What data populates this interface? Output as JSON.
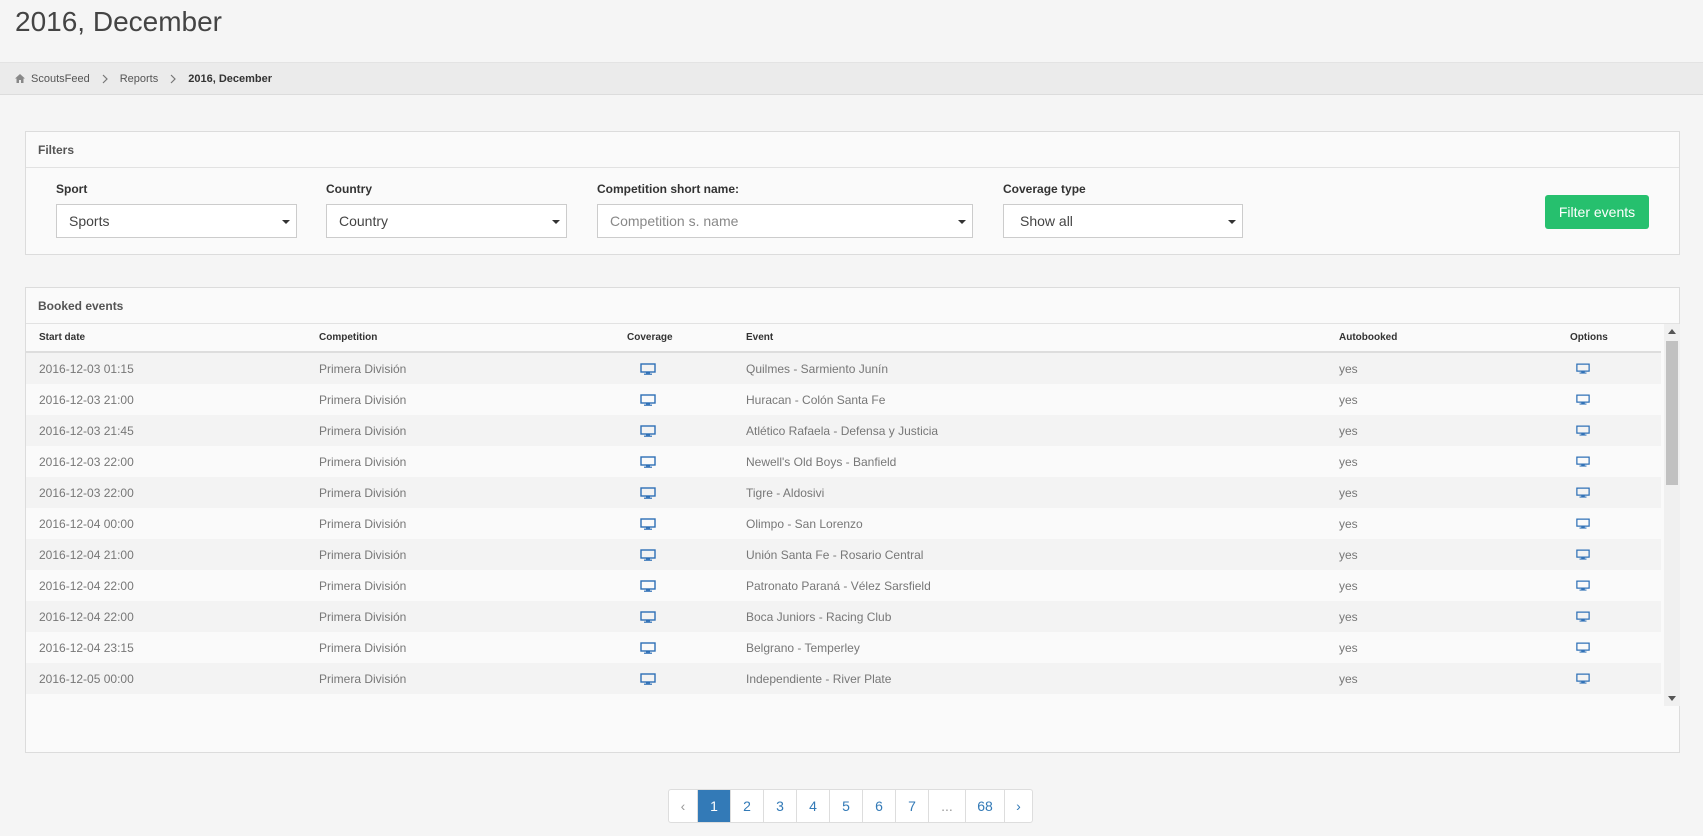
{
  "page_title": "2016, December",
  "breadcrumb": {
    "items": [
      "ScoutsFeed",
      "Reports",
      "2016, December"
    ]
  },
  "filters": {
    "heading": "Filters",
    "sport": {
      "label": "Sport",
      "value": "Sports"
    },
    "country": {
      "label": "Country",
      "value": "Country"
    },
    "competition": {
      "label": "Competition short name:",
      "placeholder": "Competition s. name"
    },
    "coverage": {
      "label": "Coverage type",
      "value": "Show all"
    },
    "button": "Filter events",
    "button_color": "#26c06e"
  },
  "booked": {
    "heading": "Booked events",
    "columns": [
      "Start date",
      "Competition",
      "Coverage",
      "Event",
      "Autobooked",
      "Options"
    ],
    "rows": [
      {
        "start": "2016-12-03 01:15",
        "competition": "Primera División",
        "coverage_icon": "monitor-icon",
        "event": "Quilmes - Sarmiento Junín",
        "autobooked": "yes",
        "options_icon": "monitor-icon"
      },
      {
        "start": "2016-12-03 21:00",
        "competition": "Primera División",
        "coverage_icon": "monitor-icon",
        "event": "Huracan - Colón Santa Fe",
        "autobooked": "yes",
        "options_icon": "monitor-icon"
      },
      {
        "start": "2016-12-03 21:45",
        "competition": "Primera División",
        "coverage_icon": "monitor-icon",
        "event": "Atlético Rafaela - Defensa y Justicia",
        "autobooked": "yes",
        "options_icon": "monitor-icon"
      },
      {
        "start": "2016-12-03 22:00",
        "competition": "Primera División",
        "coverage_icon": "monitor-icon",
        "event": "Newell's Old Boys - Banfield",
        "autobooked": "yes",
        "options_icon": "monitor-icon"
      },
      {
        "start": "2016-12-03 22:00",
        "competition": "Primera División",
        "coverage_icon": "monitor-icon",
        "event": "Tigre - Aldosivi",
        "autobooked": "yes",
        "options_icon": "monitor-icon"
      },
      {
        "start": "2016-12-04 00:00",
        "competition": "Primera División",
        "coverage_icon": "monitor-icon",
        "event": "Olimpo - San Lorenzo",
        "autobooked": "yes",
        "options_icon": "monitor-icon"
      },
      {
        "start": "2016-12-04 21:00",
        "competition": "Primera División",
        "coverage_icon": "monitor-icon",
        "event": "Unión Santa Fe - Rosario Central",
        "autobooked": "yes",
        "options_icon": "monitor-icon"
      },
      {
        "start": "2016-12-04 22:00",
        "competition": "Primera División",
        "coverage_icon": "monitor-icon",
        "event": "Patronato Paraná - Vélez Sarsfield",
        "autobooked": "yes",
        "options_icon": "monitor-icon"
      },
      {
        "start": "2016-12-04 22:00",
        "competition": "Primera División",
        "coverage_icon": "monitor-icon",
        "event": "Boca Juniors - Racing Club",
        "autobooked": "yes",
        "options_icon": "monitor-icon"
      },
      {
        "start": "2016-12-04 23:15",
        "competition": "Primera División",
        "coverage_icon": "monitor-icon",
        "event": "Belgrano - Temperley",
        "autobooked": "yes",
        "options_icon": "monitor-icon"
      },
      {
        "start": "2016-12-05 00:00",
        "competition": "Primera División",
        "coverage_icon": "monitor-icon",
        "event": "Independiente - River Plate",
        "autobooked": "yes",
        "options_icon": "monitor-icon"
      }
    ]
  },
  "pagination": {
    "prev": "‹",
    "pages": [
      "1",
      "2",
      "3",
      "4",
      "5",
      "6",
      "7",
      "...",
      "68"
    ],
    "current": "1",
    "next": "›",
    "active_color": "#337ab7"
  }
}
